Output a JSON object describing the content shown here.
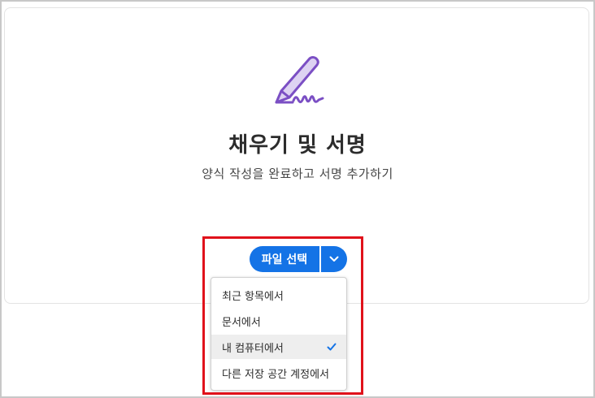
{
  "main": {
    "title": "채우기 및 서명",
    "subtitle": "양식 작성을 완료하고 서명 추가하기",
    "icon": "pen-signature-icon"
  },
  "file_button": {
    "label": "파일 선택",
    "dropdown_icon": "chevron-down-icon",
    "color": "#1473e6"
  },
  "menu": {
    "items": [
      {
        "label": "최근 항목에서",
        "selected": false
      },
      {
        "label": "문서에서",
        "selected": false
      },
      {
        "label": "내 컴퓨터에서",
        "selected": true
      },
      {
        "label": "다른 저장 공간 계정에서",
        "selected": false
      }
    ],
    "check_icon": "checkmark-icon"
  },
  "highlight_color": "#e0121b"
}
